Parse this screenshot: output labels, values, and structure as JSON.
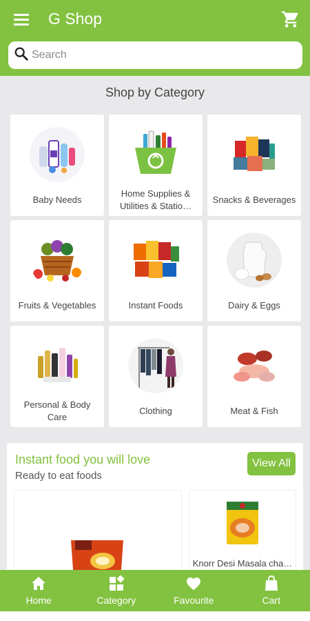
{
  "header": {
    "title": "G Shop",
    "menu_icon": "hamburger-menu-icon",
    "cart_icon": "shopping-cart-icon"
  },
  "search": {
    "placeholder": "Search",
    "icon": "search-icon"
  },
  "categories_section": {
    "title": "Shop by Category",
    "items": [
      {
        "label": "Baby Needs",
        "icon": "baby-products-image"
      },
      {
        "label": "Home Supplies & Utilities & Statio…",
        "icon": "home-supplies-basket-image"
      },
      {
        "label": "Snacks & Beverages",
        "icon": "snacks-beverages-image"
      },
      {
        "label": "Fruits & Vegetables",
        "icon": "fruit-basket-image"
      },
      {
        "label": "Instant Foods",
        "icon": "instant-foods-image"
      },
      {
        "label": "Dairy & Eggs",
        "icon": "milk-eggs-image"
      },
      {
        "label": "Personal & Body Care",
        "icon": "personal-care-image"
      },
      {
        "label": "Clothing",
        "icon": "clothing-rack-image"
      },
      {
        "label": "Meat & Fish",
        "icon": "meat-fish-image"
      }
    ]
  },
  "promo": {
    "title": "Instant food you will love",
    "subtitle": "Ready to eat foods",
    "view_all_label": "View All",
    "products": [
      {
        "name": "",
        "icon": "instant-food-cup-image"
      },
      {
        "name": "Knorr Desi Masala cha…",
        "icon": "knorr-noodles-pack-image"
      }
    ]
  },
  "bottom_nav": [
    {
      "label": "Home",
      "icon": "home-icon"
    },
    {
      "label": "Category",
      "icon": "category-grid-icon"
    },
    {
      "label": "Favourite",
      "icon": "heart-icon"
    },
    {
      "label": "Cart",
      "icon": "shopping-bag-icon"
    }
  ],
  "colors": {
    "brand_green": "#82c240",
    "background": "#e9e9ec"
  }
}
